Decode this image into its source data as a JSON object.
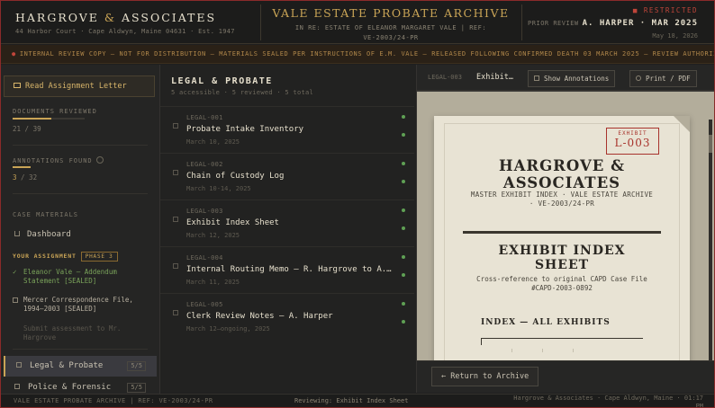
{
  "header": {
    "firm_left": "HARGROVE",
    "firm_amp": "&",
    "firm_right": "ASSOCIATES",
    "firm_sub": "44 Harbor Court · Cape Aldwyn, Maine 04631 · Est. 1947",
    "archive_title": "VALE ESTATE PROBATE ARCHIVE",
    "archive_sub_1": "IN RE: ESTATE OF ELEANOR MARGARET VALE  |  REF:",
    "archive_sub_2": "VE-2003/24-PR",
    "restricted": "■ RESTRICTED",
    "prior_label": "PRIOR REVIEW",
    "prior_value": "A. HARPER · MAR 2025",
    "date_small": "May 18, 2026"
  },
  "banner": {
    "text": "INTERNAL REVIEW COPY — NOT FOR DISTRIBUTION — MATERIALS SEALED PER INSTRUCTIONS OF E.M. VALE — RELEASED FOLLOWING CONFIRMED DEATH 03 MARCH 2025 — REVIEW AUTHORIZED"
  },
  "sidebar": {
    "read_button": "Read Assignment Letter",
    "documents_reviewed_label": "DOCUMENTS REVIEWED",
    "documents_reviewed_progress": 0.54,
    "documents_reviewed_value": "21 / 39",
    "annotations_label": "ANNOTATIONS FOUND",
    "annotations_found": "3",
    "annotations_total": " / 32",
    "case_materials_label": "CASE MATERIALS",
    "dashboard": "Dashboard",
    "your_assignment": "YOUR ASSIGNMENT",
    "phase": "PHASE 3",
    "tasks": [
      {
        "mark": "✓",
        "text": "Eleanor Vale — Addendum Statement [SEALED]"
      },
      {
        "mark": "",
        "text": "Mercer Correspondence File, 1994–2003 [SEALED]"
      },
      {
        "mark": "",
        "text": "Submit assessment to Mr. Hargrove"
      }
    ],
    "nav": [
      {
        "label": "Legal & Probate",
        "count": "5/5"
      },
      {
        "label": "Police & Forensic",
        "count": "5/5"
      }
    ]
  },
  "list": {
    "title": "LEGAL & PROBATE",
    "subtitle": "5 accessible · 5 reviewed · 5 total",
    "items": [
      {
        "code": "LEGAL-001",
        "title": "Probate Intake Inventory",
        "date": "March 10, 2025"
      },
      {
        "code": "LEGAL-002",
        "title": "Chain of Custody Log",
        "date": "March 10-14, 2025"
      },
      {
        "code": "LEGAL-003",
        "title": "Exhibit Index Sheet",
        "date": "March 12, 2025"
      },
      {
        "code": "LEGAL-004",
        "title": "Internal Routing Memo — R. Hargrove to A. Harper",
        "date": "March 11, 2025"
      },
      {
        "code": "LEGAL-005",
        "title": "Clerk Review Notes — A. Harper",
        "date": "March 12–ongoing, 2025"
      }
    ]
  },
  "viewer": {
    "code": "LEGAL-003",
    "name": "Exhibit Index Sheet",
    "show_annotations": "Show Annotations",
    "print": "Print / PDF",
    "stamp_label": "EXHIBIT",
    "stamp_code": "L-003",
    "page_firm_1": "HARGROVE &",
    "page_firm_2": "ASSOCIATES",
    "page_firm_sub": "MASTER EXHIBIT INDEX · VALE ESTATE ARCHIVE · VE-2003/24-PR",
    "page_title": "EXHIBIT INDEX SHEET",
    "page_sub": "Cross-reference to original CAPD Case File #CAPD-2003-0892",
    "page_index": "INDEX — ALL EXHIBITS",
    "return_button": "← Return to Archive"
  },
  "footer": {
    "left": "VALE ESTATE PROBATE ARCHIVE  |  REF: VE-2003/24-PR",
    "mid": "Reviewing: Exhibit Index Sheet",
    "right_1": "Hargrove & Associates · Cape Aldwyn, Maine · 01:17",
    "right_2": "PM"
  }
}
